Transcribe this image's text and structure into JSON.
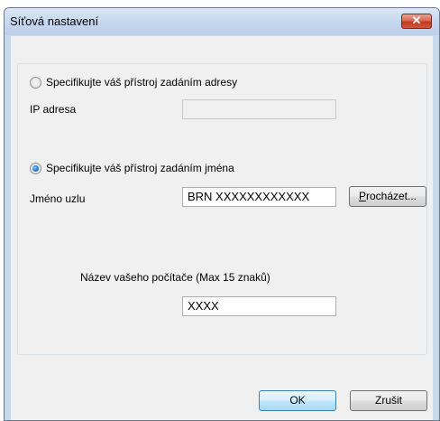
{
  "window": {
    "title": "Síťová nastavení"
  },
  "address_option": {
    "label": "Specifikujte váš přístroj zadáním adresy",
    "checked": false
  },
  "ip": {
    "label": "IP adresa",
    "value": ""
  },
  "name_option": {
    "label": "Specifikujte váš přístroj zadáním jména",
    "checked": true
  },
  "node": {
    "label": "Jméno uzlu",
    "value": "BRN XXXXXXXXXXXX",
    "browse_mnemonic": "P",
    "browse_rest": "rocházet..."
  },
  "computer": {
    "label": "Název vašeho počítače (Max 15 znaků)",
    "value": "XXXX"
  },
  "buttons": {
    "ok": "OK",
    "cancel": "Zrušit"
  },
  "icons": {
    "close": "close-icon"
  }
}
